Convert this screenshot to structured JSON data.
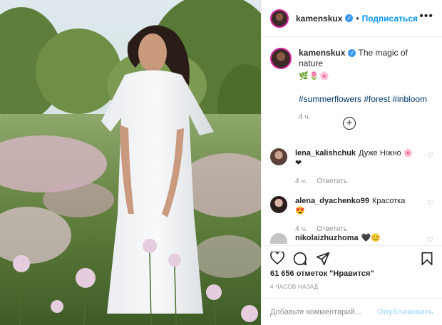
{
  "header": {
    "username": "kamenskux",
    "verified_icon": "verified-badge-icon",
    "separator": "•",
    "follow_label": "Подписаться",
    "more_icon": "more-options-icon"
  },
  "caption": {
    "username": "kamenskux",
    "text": "The magic of nature",
    "emoji": "🌿🌷🌸",
    "hashtags": "#summerflowers #forest #inbloom",
    "time": "4 ч."
  },
  "load_more_icon": "plus-circle-icon",
  "comments": [
    {
      "username": "lena_kalishchuk",
      "text": "Дуже Ніжно 🌸❤",
      "time": "4 ч.",
      "reply": "Ответить"
    },
    {
      "username": "alena_dyachenko99",
      "text": "Красотка 😍",
      "time": "4 ч.",
      "reply": "Ответить"
    },
    {
      "username": "nikolaizhuzhoma",
      "text": "🖤😊"
    }
  ],
  "actions": {
    "like_icon": "heart-icon",
    "comment_icon": "comment-icon",
    "share_icon": "share-icon",
    "save_icon": "bookmark-icon"
  },
  "likes": "61 656 отметок \"Нравится\"",
  "age": "4 ЧАСОВ НАЗАД",
  "add_comment": {
    "placeholder": "Добавьте комментарий...",
    "publish_label": "Опубликовать"
  },
  "colors": {
    "accent": "#0095f6",
    "verified": "#3897f0",
    "text": "#262626",
    "muted": "#8e8e8e",
    "publish_disabled": "#b2dffc"
  }
}
